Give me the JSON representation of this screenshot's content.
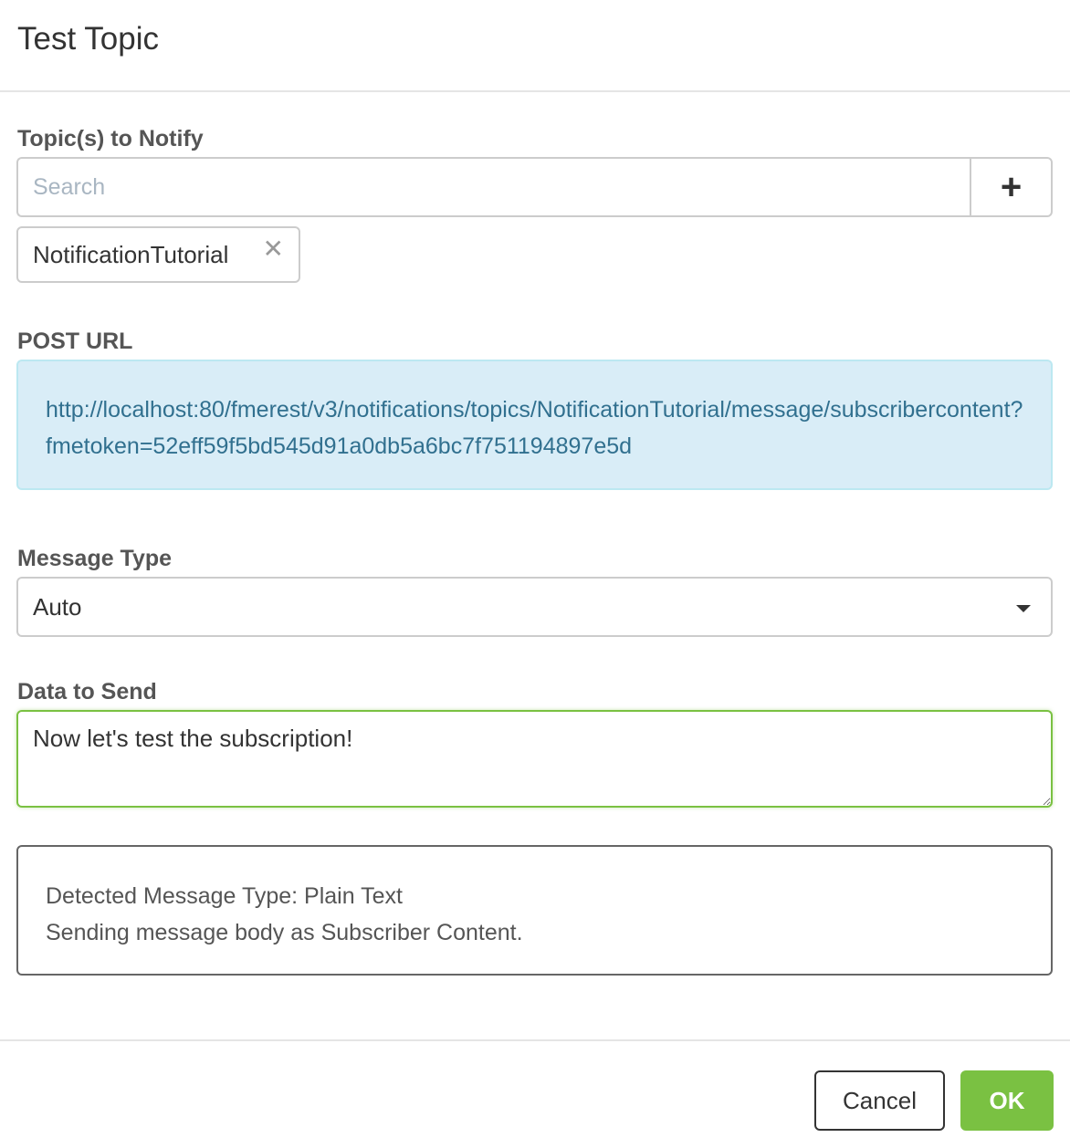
{
  "dialog": {
    "title": "Test Topic"
  },
  "topics": {
    "label": "Topic(s) to Notify",
    "search_placeholder": "Search",
    "add_button_label": "+",
    "selected": [
      {
        "label": "NotificationTutorial",
        "remove_glyph": "✕"
      }
    ]
  },
  "post_url": {
    "label": "POST URL",
    "value": "http://localhost:80/fmerest/v3/notifications/topics/NotificationTutorial/message/subscribercontent?fmetoken=52eff59f5bd545d91a0db5a6bc7f751194897e5d"
  },
  "message_type": {
    "label": "Message Type",
    "selected": "Auto"
  },
  "data_to_send": {
    "label": "Data to Send",
    "value": "Now let's test the subscription!"
  },
  "info": {
    "line1": "Detected Message Type: Plain Text",
    "line2": "Sending message body as Subscriber Content."
  },
  "footer": {
    "cancel_label": "Cancel",
    "ok_label": "OK"
  },
  "colors": {
    "accent_green": "#7ac142",
    "info_bg": "#d9edf7",
    "info_text": "#31708f"
  }
}
